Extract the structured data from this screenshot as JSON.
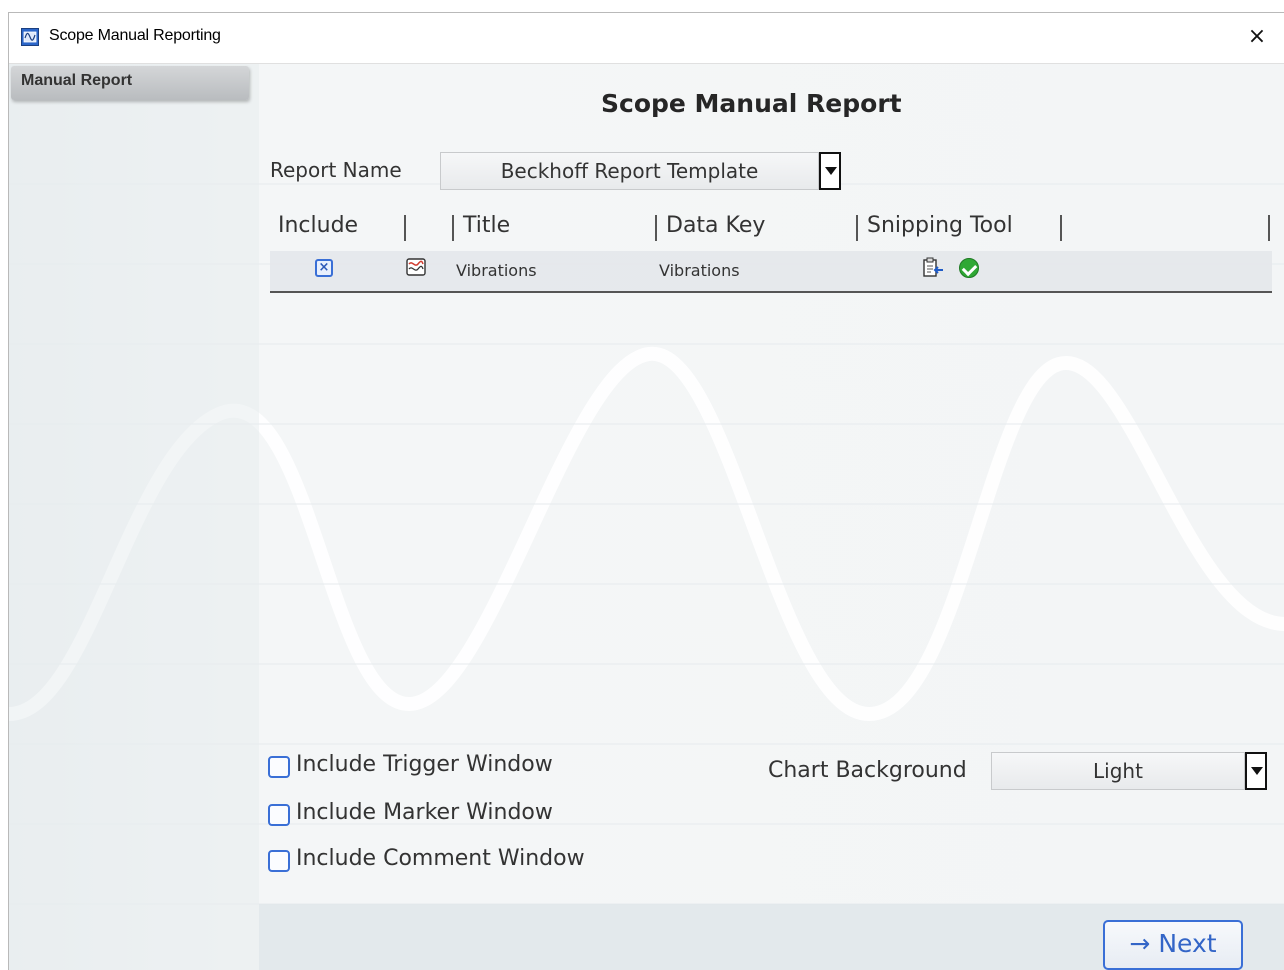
{
  "window": {
    "title": "Scope Manual Reporting",
    "close_label": "×"
  },
  "sidebar": {
    "items": [
      {
        "label": "Manual Report"
      }
    ]
  },
  "main": {
    "title": "Scope Manual Report",
    "report_name_label": "Report Name",
    "report_name_value": "Beckhoff Report Template",
    "table": {
      "columns": [
        "Include",
        "",
        "Title",
        "Data Key",
        "Snipping Tool"
      ],
      "rows": [
        {
          "include": "checked",
          "title": "Vibrations",
          "data_key": "Vibrations",
          "snipping_tool_status": "ok"
        }
      ]
    },
    "options": {
      "include_trigger_window": "Include Trigger Window",
      "include_marker_window": "Include Marker Window",
      "include_comment_window": "Include Comment Window",
      "chart_background_label": "Chart Background",
      "chart_background_value": "Light"
    },
    "next_label": "→ Next"
  },
  "colors": {
    "accent": "#3a6fd6",
    "ok": "#2fa834",
    "icon_blue": "#2b66c9"
  }
}
